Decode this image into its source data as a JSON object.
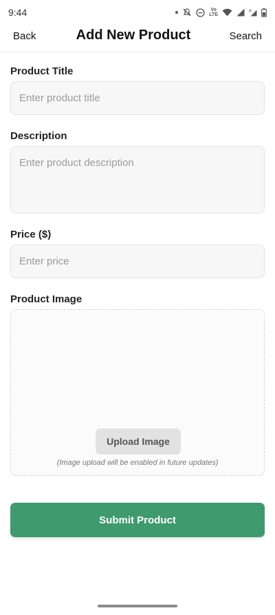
{
  "status_bar": {
    "time": "9:44",
    "icons": [
      "notification-dot-icon",
      "bell-off-icon",
      "do-not-disturb-icon",
      "volte-icon",
      "wifi-icon",
      "signal-icon",
      "signal-r-icon",
      "battery-icon"
    ],
    "volte_top": "Vo",
    "volte_bottom": "LTE"
  },
  "header": {
    "back_label": "Back",
    "title": "Add New Product",
    "search_label": "Search"
  },
  "form": {
    "title": {
      "label": "Product Title",
      "placeholder": "Enter product title"
    },
    "description": {
      "label": "Description",
      "placeholder": "Enter product description"
    },
    "price": {
      "label": "Price ($)",
      "placeholder": "Enter price"
    },
    "image": {
      "label": "Product Image",
      "upload_label": "Upload Image",
      "note": "(Image upload will be enabled in future updates)"
    },
    "submit_label": "Submit Product"
  },
  "colors": {
    "accent": "#3f9a6e",
    "field_bg": "#f7f7f8",
    "upload_btn_bg": "#e2e2e2"
  }
}
